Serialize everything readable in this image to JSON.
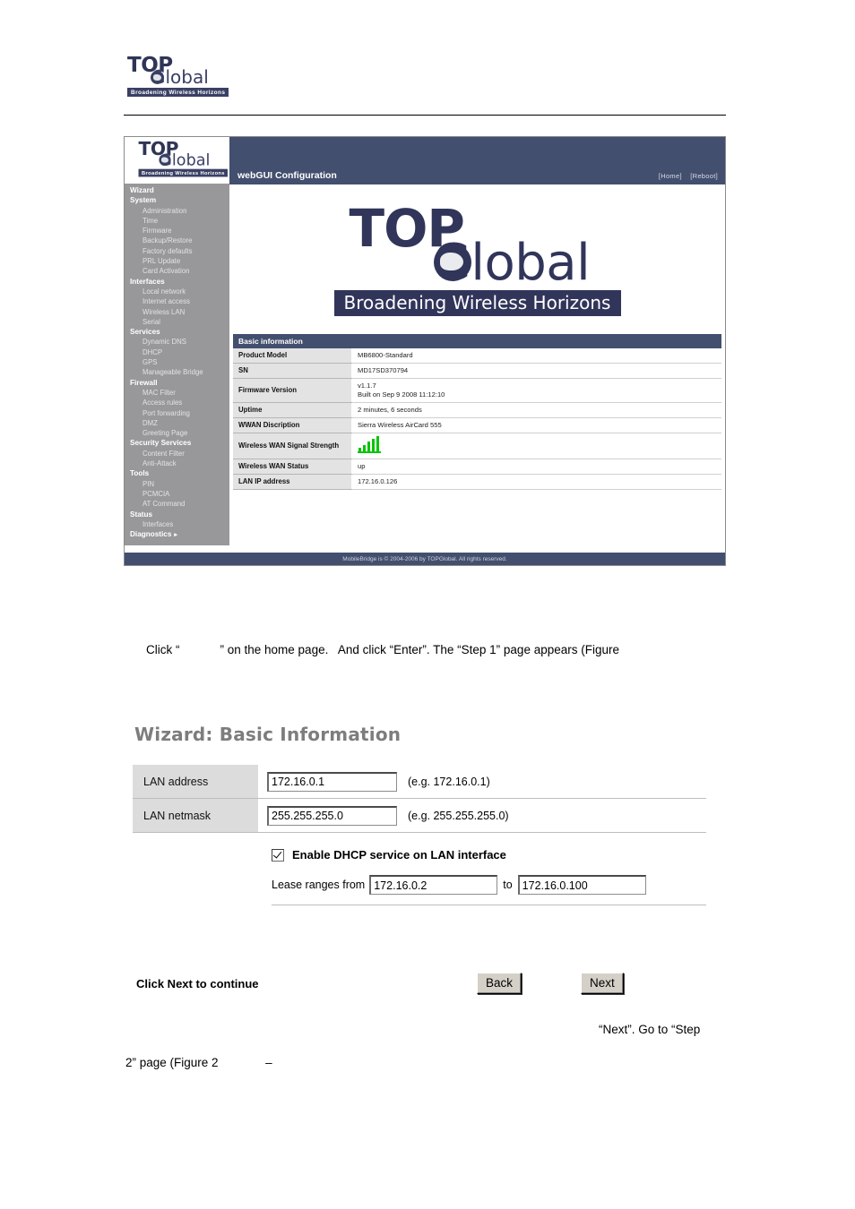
{
  "document": {
    "brand": {
      "top": "TOP",
      "global": "Global",
      "tagline": "Broadening Wireless Horizons"
    },
    "paragraphs": {
      "click_line": "Click “            ” on the home page.   And click “Enter”. The “Step 1” page appears (Figure",
      "next_line": "“Next”. Go to “Step",
      "step2_line": "2” page (Figure 2              –"
    }
  },
  "webgui": {
    "title": "webGUI Configuration",
    "links": [
      {
        "label": "[Home]"
      },
      {
        "label": "[Reboot]"
      }
    ],
    "footer": "MobileBridge is © 2004-2006 by TOPGlobal. All rights reserved.",
    "sidebar": {
      "items": [
        {
          "label": "Wizard",
          "level": "top"
        },
        {
          "label": "System",
          "level": "top"
        },
        {
          "label": "Administration",
          "level": "sub"
        },
        {
          "label": "Time",
          "level": "sub"
        },
        {
          "label": "Firmware",
          "level": "sub"
        },
        {
          "label": "Backup/Restore",
          "level": "sub"
        },
        {
          "label": "Factory defaults",
          "level": "sub"
        },
        {
          "label": "PRL Update",
          "level": "sub"
        },
        {
          "label": "Card Activation",
          "level": "sub"
        },
        {
          "label": "Interfaces",
          "level": "top"
        },
        {
          "label": "Local network",
          "level": "sub"
        },
        {
          "label": "Internet access",
          "level": "sub"
        },
        {
          "label": "Wireless LAN",
          "level": "sub"
        },
        {
          "label": "Serial",
          "level": "sub"
        },
        {
          "label": "Services",
          "level": "top"
        },
        {
          "label": "Dynamic DNS",
          "level": "sub"
        },
        {
          "label": "DHCP",
          "level": "sub"
        },
        {
          "label": "GPS",
          "level": "sub"
        },
        {
          "label": "Manageable Bridge",
          "level": "sub"
        },
        {
          "label": "Firewall",
          "level": "top"
        },
        {
          "label": "MAC Filter",
          "level": "sub"
        },
        {
          "label": "Access rules",
          "level": "sub"
        },
        {
          "label": "Port forwarding",
          "level": "sub"
        },
        {
          "label": "DMZ",
          "level": "sub"
        },
        {
          "label": "Greeting Page",
          "level": "sub"
        },
        {
          "label": "Security Services",
          "level": "top"
        },
        {
          "label": "Content Filter",
          "level": "sub"
        },
        {
          "label": "Anti-Attack",
          "level": "sub"
        },
        {
          "label": "Tools",
          "level": "top"
        },
        {
          "label": "PIN",
          "level": "sub"
        },
        {
          "label": "PCMCIA",
          "level": "sub"
        },
        {
          "label": "AT Command",
          "level": "sub"
        },
        {
          "label": "Status",
          "level": "top"
        },
        {
          "label": "Interfaces",
          "level": "sub"
        },
        {
          "label": "Diagnostics",
          "level": "top",
          "arrow": "▸"
        }
      ]
    },
    "basic_information": {
      "header": "Basic information",
      "rows": [
        {
          "label": "Product Model",
          "value": "MB6800-Standard"
        },
        {
          "label": "SN",
          "value": "MD17SD370794"
        },
        {
          "label": "Firmware Version",
          "value": "v1.1.7\nBuilt on Sep 9 2008 11:12:10"
        },
        {
          "label": "Uptime",
          "value": "2 minutes, 6 seconds"
        },
        {
          "label": "WWAN Discription",
          "value": "Sierra Wireless AirCard 555"
        },
        {
          "label": "Wireless WAN Signal Strength",
          "value": "",
          "icon": "signal-strength-icon",
          "bars": 5
        },
        {
          "label": "Wireless WAN Status",
          "value": "up"
        },
        {
          "label": "LAN IP address",
          "value": "172.16.0.126"
        }
      ]
    },
    "colors": {
      "header_bar": "#434f6e",
      "sidebar_bg": "#98989a",
      "label_cell": "#e3e3e3",
      "signal_green": "#0bc40b",
      "brand_navy": "#31355a"
    }
  },
  "wizard": {
    "title": "Wizard: Basic Information",
    "fields": [
      {
        "label": "LAN address",
        "value": "172.16.0.1",
        "hint": "(e.g. 172.16.0.1)"
      },
      {
        "label": "LAN netmask",
        "value": "255.255.255.0",
        "hint": "(e.g. 255.255.255.0)"
      }
    ],
    "dhcp": {
      "checkbox_label": "Enable DHCP service on LAN interface",
      "checked": true,
      "lease_prefix": "Lease ranges from",
      "lease_from": "172.16.0.2",
      "lease_to_label": "to",
      "lease_to": "172.16.0.100"
    },
    "footer": {
      "continue_text": "Click Next to continue",
      "back_label": "Back",
      "next_label": "Next"
    }
  }
}
